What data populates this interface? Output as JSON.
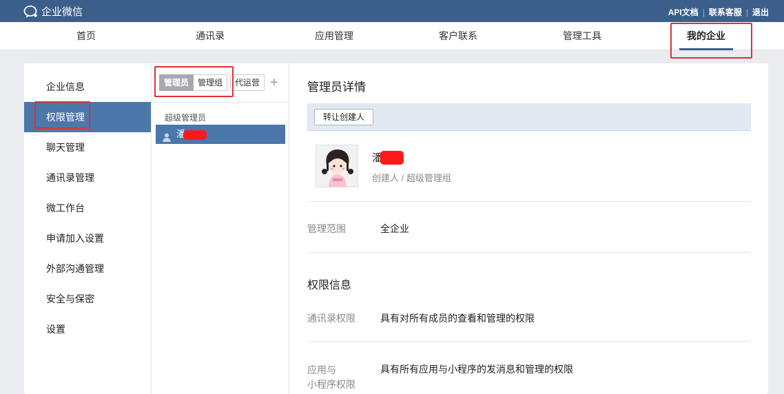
{
  "app": {
    "logo_text": "企业微信",
    "links": [
      "API文档",
      "联系客服",
      "退出"
    ]
  },
  "nav": {
    "items": [
      "首页",
      "通讯录",
      "应用管理",
      "客户联系",
      "管理工具",
      "我的企业"
    ],
    "active": "我的企业"
  },
  "sidebar": {
    "items": [
      "企业信息",
      "权限管理",
      "聊天管理",
      "通讯录管理",
      "微工作台",
      "申请加入设置",
      "外部沟通管理",
      "安全与保密",
      "设置"
    ],
    "active": "权限管理"
  },
  "middle": {
    "tabs": [
      "管理员",
      "管理组"
    ],
    "extra_tab": "代运营",
    "add_symbol": "+",
    "group_label": "超级管理员",
    "admin_name_visible": "潘"
  },
  "detail": {
    "title": "管理员详情",
    "transfer_button": "转让创建人",
    "person_name_visible": "潘",
    "person_role": "创建人 / 超级管理组",
    "scope_label": "管理范围",
    "scope_value": "全企业",
    "permissions_title": "权限信息",
    "contacts_perm_label": "通讯录权限",
    "contacts_perm_value": "具有对所有成员的查看和管理的权限",
    "app_perm_label_line1": "应用与",
    "app_perm_label_line2": "小程序权限",
    "app_perm_value": "具有所有应用与小程序的发消息和管理的权限"
  },
  "colors": {
    "topbar": "#3b5f8a",
    "accent": "#4b77ab",
    "highlight_box": "#e03030",
    "redaction": "#ff1a1a"
  }
}
